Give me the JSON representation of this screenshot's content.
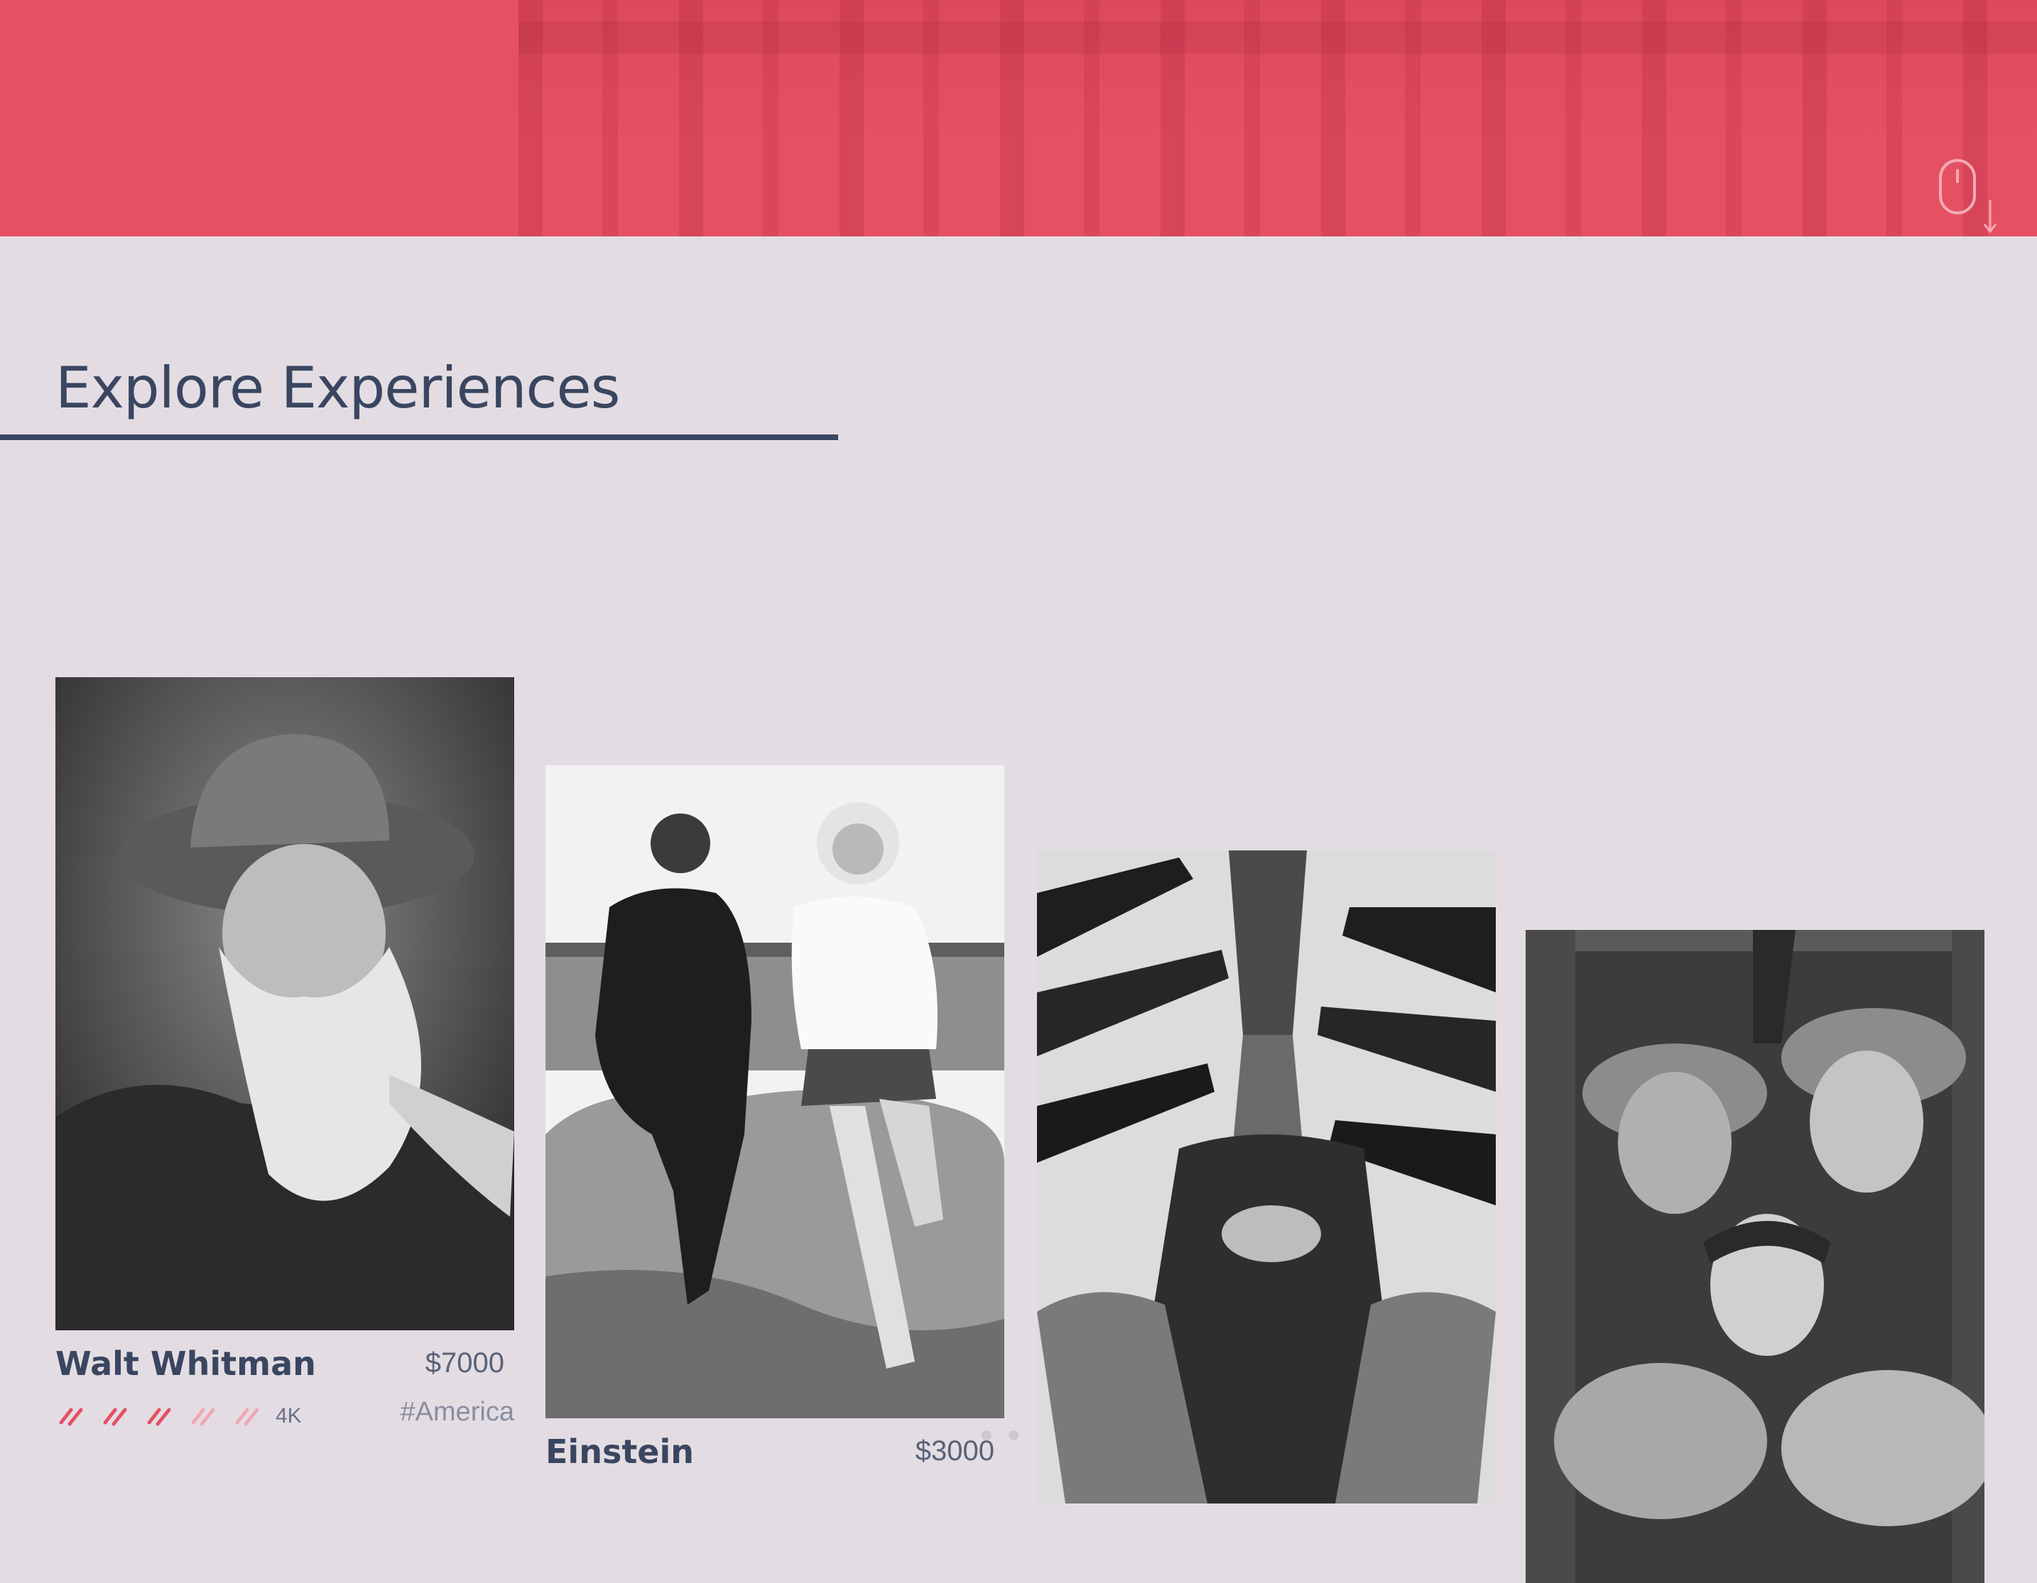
{
  "hero": {
    "accent_color": "#e65063",
    "scroll_icon": "mouse-scroll-down-icon"
  },
  "section": {
    "title": "Explore Experiences",
    "text_color": "#3a4660"
  },
  "cards": [
    {
      "name": "Walt Whitman",
      "price": "$7000",
      "rating_filled": 3,
      "rating_total": 5,
      "rating_count": "4K",
      "tag": "#America",
      "photo": "walt-whitman-portrait"
    },
    {
      "name": "Einstein",
      "price": "$3000",
      "photo": "einstein-on-rock-photo"
    },
    {
      "photo": "sailors-waving-photo"
    },
    {
      "photo": "soldiers-helmets-photo"
    }
  ],
  "carousel": {
    "dots": 2
  }
}
